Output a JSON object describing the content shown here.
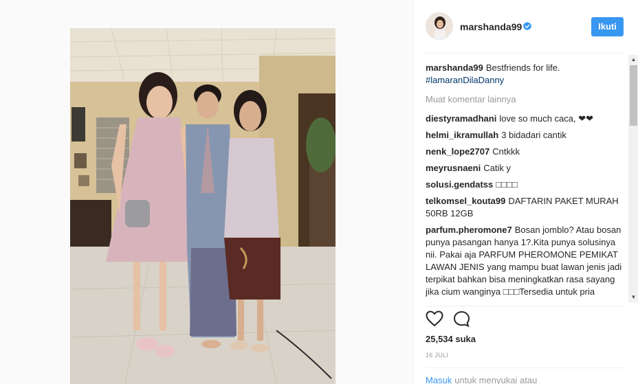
{
  "post": {
    "username": "marshanda99",
    "follow_label": "Ikuti",
    "caption": {
      "user": "marshanda99",
      "text": "Bestfriends for life.",
      "hashtag": "#lamaranDilaDanny"
    },
    "load_more_label": "Muat komentar lainnya",
    "comments": [
      {
        "user": "diestyramadhani",
        "text": "love so much caca, ❤❤"
      },
      {
        "user": "helmi_ikramullah",
        "text": "3 bidadari cantik"
      },
      {
        "user": "nenk_lope2707",
        "text": "Cntkkk"
      },
      {
        "user": "meyrusnaeni",
        "text": "Catik y"
      },
      {
        "user": "solusi.gendatss",
        "text": "□□□□"
      },
      {
        "user": "telkomsel_kouta99",
        "text": "DAFTARIN PAKET MURAH 50RB 12GB"
      },
      {
        "user": "parfum.pheromone7",
        "text": "Bosan jomblo? Atau bosan punya pasangan hanya 1?.Kita punya solusinya nii. Pakai aja PARFUM PHEROMONE PEMIKAT LAWAN JENIS yang mampu buat lawan jenis jadi terpikat bahkan bisa meningkatkan rasa sayang jika cium wanginya □□□Tersedia untuk pria"
      }
    ],
    "likes": "25,534 suka",
    "date": "16 JULI",
    "login_link": "Masuk",
    "login_text": "untuk menyukai atau"
  },
  "icons": {
    "verified": "verified-badge-icon",
    "like": "heart-icon",
    "comment": "comment-bubble-icon"
  },
  "colors": {
    "accent": "#3897f0",
    "hashtag": "#003569",
    "muted": "#999999"
  }
}
